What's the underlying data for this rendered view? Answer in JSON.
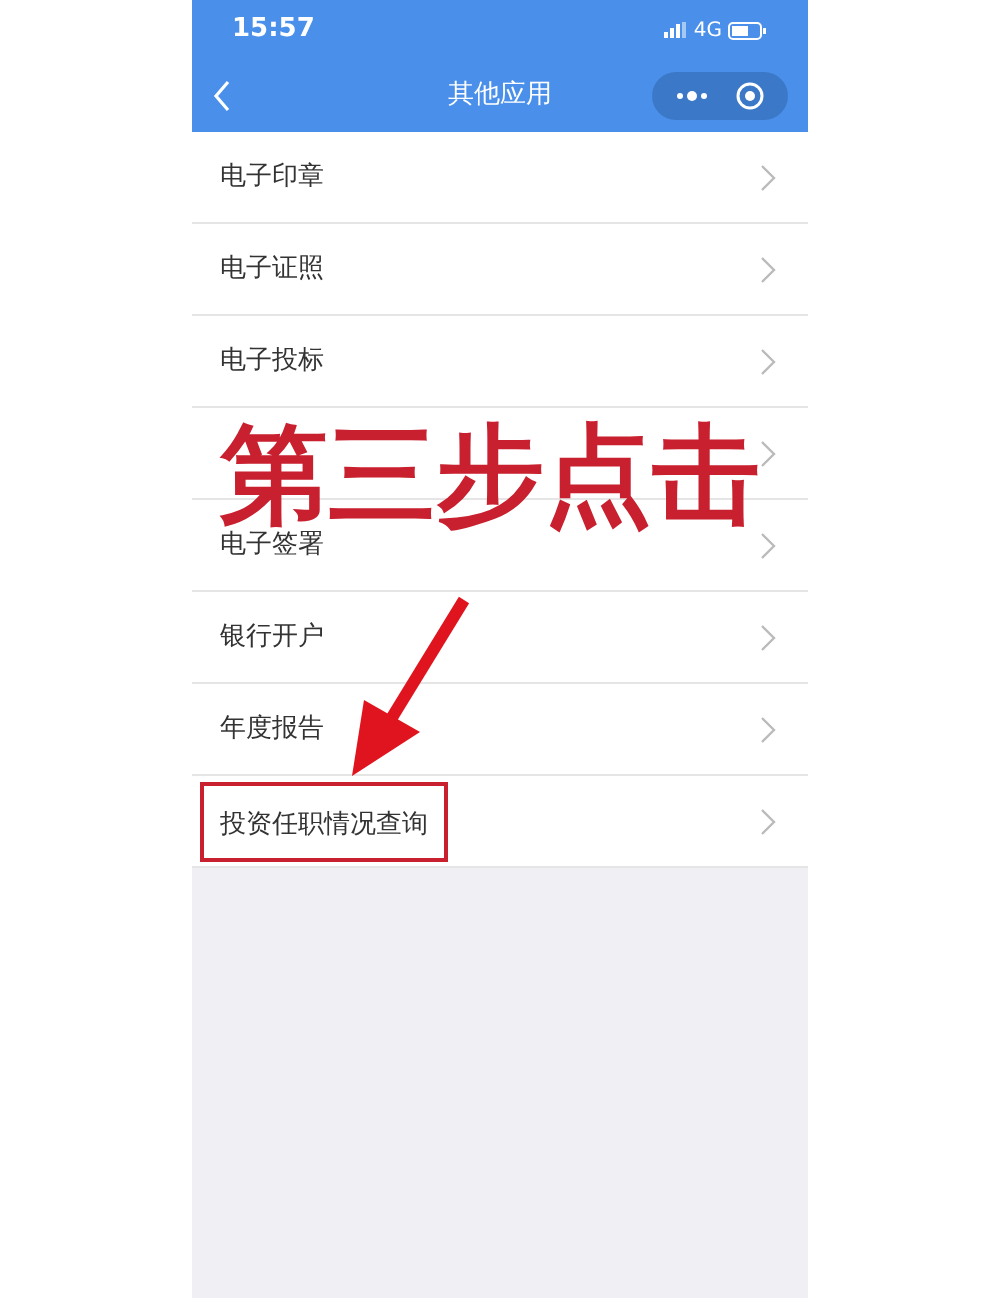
{
  "status_bar": {
    "time": "15:57",
    "network": "4G"
  },
  "nav": {
    "title": "其他应用"
  },
  "items": [
    {
      "label": "电子印章",
      "highlighted": false
    },
    {
      "label": "电子证照",
      "highlighted": false
    },
    {
      "label": "电子投标",
      "highlighted": false
    },
    {
      "highlighted": false
    },
    {
      "label": "电子签署",
      "highlighted": false
    },
    {
      "label": "银行开户",
      "highlighted": false
    },
    {
      "label": "年度报告",
      "highlighted": false
    },
    {
      "label": "投资任职情况查询",
      "highlighted": true
    }
  ],
  "annotation": {
    "text": "第三步点击"
  }
}
